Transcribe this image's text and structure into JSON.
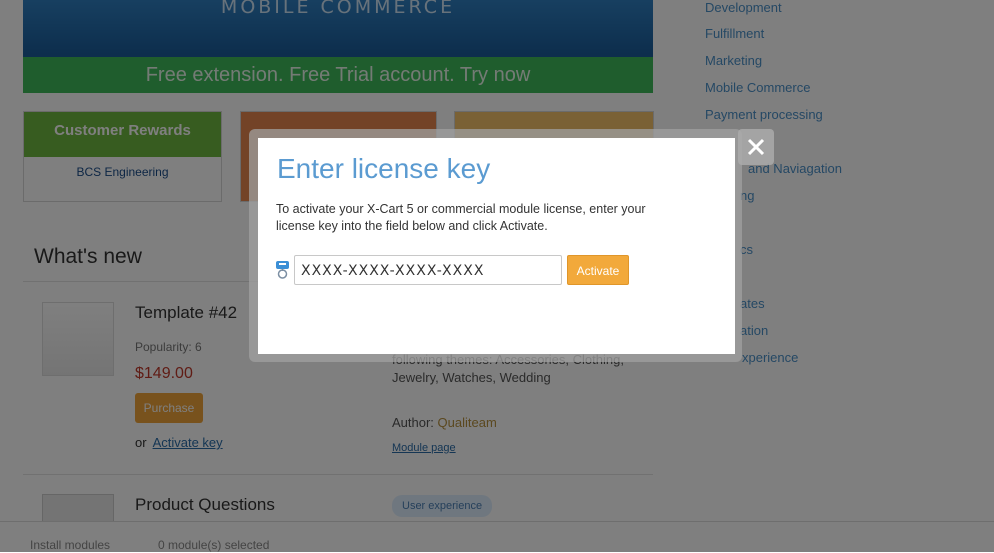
{
  "banner": {
    "title": "MOBILE COMMERCE",
    "strip": "Free extension. Free Trial account. Try now"
  },
  "tiles": {
    "tile1_title": "Customer Rewards",
    "tile1_logo": "BCS Engineering"
  },
  "sidebar": {
    "items": [
      {
        "label": "Development"
      },
      {
        "label": "Fulfillment"
      },
      {
        "label": "Marketing"
      },
      {
        "label": "Mobile Commerce"
      },
      {
        "label": "Payment processing"
      },
      {
        "label": "and Naviagation"
      },
      {
        "label": "ng"
      },
      {
        "label": "cs"
      },
      {
        "label": "ates"
      },
      {
        "label": "ation"
      },
      {
        "label": "xperience"
      }
    ]
  },
  "whats_new": {
    "title": "What's new",
    "product1": {
      "name": "Template #42",
      "popularity": "Popularity: 6",
      "price": "$149.00",
      "purchase_label": "Purchase",
      "or_label": "or",
      "activate_key_label": "Activate key",
      "description": "following themes: Accessories, Clothing, Jewelry, Watches, Wedding",
      "author_label": "Author:",
      "author_name": "Qualiteam",
      "module_page": "Module page"
    },
    "product2": {
      "name": "Product Questions",
      "tag": "User experience"
    }
  },
  "bottom_bar": {
    "install": "Install modules",
    "selected": "0 module(s) selected"
  },
  "modal": {
    "title": "Enter license key",
    "text": "To activate your X-Cart 5 or commercial module license, enter your license key into the field below and click Activate.",
    "input_value": "XXXX-XXXX-XXXX-XXXX",
    "activate_label": "Activate",
    "close_icon": "close-icon",
    "key_icon": "key-icon"
  },
  "colors": {
    "accent": "#5b9bd1",
    "button": "#f2a93b"
  }
}
